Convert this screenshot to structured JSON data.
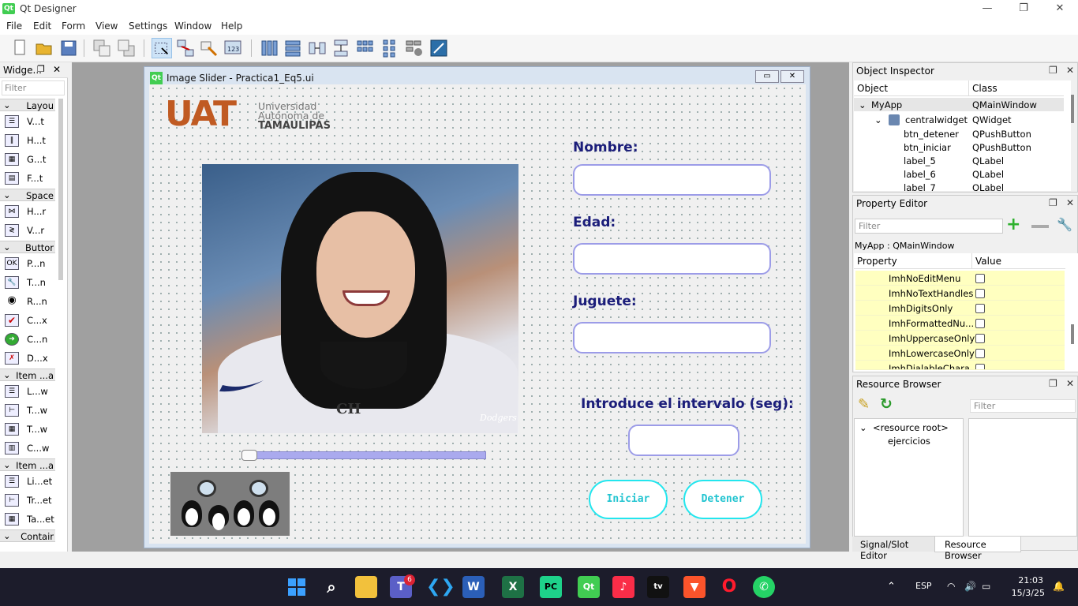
{
  "app": {
    "title": "Qt Designer",
    "icon": "Qt"
  },
  "window_controls": {
    "minimize": "—",
    "maximize": "❐",
    "close": "✕"
  },
  "menu": [
    "File",
    "Edit",
    "Form",
    "View",
    "Settings",
    "Window",
    "Help"
  ],
  "toolbar_icons": [
    "new-form-icon",
    "open-form-icon",
    "save-form-icon",
    "send-to-back-icon",
    "bring-to-front-icon",
    "edit-widgets-icon",
    "edit-signals-slots-icon",
    "edit-buddies-icon",
    "edit-tab-order-icon",
    "layout-horizontal-icon",
    "layout-vertical-icon",
    "layout-horizontal-splitter-icon",
    "layout-vertical-splitter-icon",
    "layout-grid-icon",
    "layout-form-icon",
    "break-layout-icon",
    "adjust-size-icon"
  ],
  "widget_box": {
    "title": "Widge...",
    "filter_placeholder": "Filter",
    "categories": [
      {
        "label": "Layou",
        "items": [
          {
            "icon": "vertical-layout-icon",
            "label": "V...t"
          },
          {
            "icon": "horizontal-layout-icon",
            "label": "H...t"
          },
          {
            "icon": "grid-layout-icon",
            "label": "G...t"
          },
          {
            "icon": "form-layout-icon",
            "label": "F...t"
          }
        ]
      },
      {
        "label": "Space",
        "items": [
          {
            "icon": "horizontal-spacer-icon",
            "label": "H...r"
          },
          {
            "icon": "vertical-spacer-icon",
            "label": "V...r"
          }
        ]
      },
      {
        "label": "Buttor",
        "items": [
          {
            "icon": "push-button-icon",
            "label": "P...n"
          },
          {
            "icon": "tool-button-icon",
            "label": "T...n"
          },
          {
            "icon": "radio-button-icon",
            "label": "R...n"
          },
          {
            "icon": "check-box-icon",
            "label": "C...x"
          },
          {
            "icon": "command-link-icon",
            "label": "C...n"
          },
          {
            "icon": "dialog-button-box-icon",
            "label": "D...x"
          }
        ]
      },
      {
        "label": "Item ...a",
        "items": [
          {
            "icon": "list-view-icon",
            "label": "L...w"
          },
          {
            "icon": "tree-view-icon",
            "label": "T...w"
          },
          {
            "icon": "table-view-icon",
            "label": "T...w"
          },
          {
            "icon": "column-view-icon",
            "label": "C...w"
          }
        ]
      },
      {
        "label": "Item ...a",
        "items": [
          {
            "icon": "list-widget-icon",
            "label": "Li...et"
          },
          {
            "icon": "tree-widget-icon",
            "label": "Tr...et"
          },
          {
            "icon": "table-widget-icon",
            "label": "Ta...et"
          }
        ]
      },
      {
        "label": "Contair",
        "items": []
      }
    ]
  },
  "form": {
    "title": "Image Slider - Practica1_Eq5.ui",
    "logo": {
      "letters": "UAT",
      "line1": "Universidad",
      "line2": "Autónoma de",
      "line3": "TAMAULIPAS"
    },
    "labels": {
      "nombre": "Nombre:",
      "edad": "Edad:",
      "juguete": "Juguete:",
      "intervalo": "Introduce el intervalo (seg):"
    },
    "inputs": {
      "nombre": "",
      "edad": "",
      "juguete": "",
      "intervalo": ""
    },
    "buttons": {
      "iniciar": "Iniciar",
      "detener": "Detener"
    },
    "slider": {
      "value": 0
    },
    "photo_text": {
      "shirt": "CH",
      "logo": "Dodgers"
    }
  },
  "object_inspector": {
    "title": "Object Inspector",
    "columns": [
      "Object",
      "Class"
    ],
    "rows": [
      {
        "object": "MyApp",
        "class": "QMainWindow",
        "indent": 0,
        "expanded": true
      },
      {
        "object": "centralwidget",
        "class": "QWidget",
        "indent": 1,
        "expanded": true
      },
      {
        "object": "btn_detener",
        "class": "QPushButton",
        "indent": 2
      },
      {
        "object": "btn_iniciar",
        "class": "QPushButton",
        "indent": 2
      },
      {
        "object": "label_5",
        "class": "QLabel",
        "indent": 2
      },
      {
        "object": "label_6",
        "class": "QLabel",
        "indent": 2
      },
      {
        "object": "label_7",
        "class": "QLabel",
        "indent": 2
      }
    ]
  },
  "property_editor": {
    "title": "Property Editor",
    "filter_placeholder": "Filter",
    "context": "MyApp : QMainWindow",
    "columns": [
      "Property",
      "Value"
    ],
    "rows": [
      {
        "name": "ImhNoEditMenu",
        "checked": false
      },
      {
        "name": "ImhNoTextHandles",
        "checked": false
      },
      {
        "name": "ImhDigitsOnly",
        "checked": false
      },
      {
        "name": "ImhFormattedNu...",
        "checked": false
      },
      {
        "name": "ImhUppercaseOnly",
        "checked": false
      },
      {
        "name": "ImhLowercaseOnly",
        "checked": false
      },
      {
        "name": "ImhDialableChara...",
        "checked": false
      }
    ]
  },
  "resource_browser": {
    "title": "Resource Browser",
    "filter_placeholder": "Filter",
    "tree": [
      "<resource root>",
      "ejercicios"
    ]
  },
  "bottom_tabs": [
    "Signal/Slot Editor",
    "Resource Browser"
  ],
  "taskbar": {
    "apps": [
      "windows-start-icon",
      "search-icon",
      "file-explorer-icon",
      "teams-icon",
      "vscode-icon",
      "word-icon",
      "excel-icon",
      "pycharm-icon",
      "qt-designer-icon",
      "apple-music-icon",
      "apple-tv-icon",
      "brave-icon",
      "opera-icon",
      "whatsapp-icon"
    ],
    "teams_badge": "6",
    "tray": {
      "lang": "ESP",
      "time": "21:03",
      "date": "15/3/25"
    }
  }
}
